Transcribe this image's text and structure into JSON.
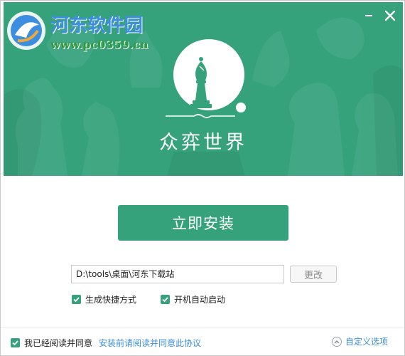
{
  "watermark": {
    "title": "河东软件园",
    "url": "www.pc0359.cn"
  },
  "header": {
    "brand": "众弈世界",
    "minimize_icon": "minimize-icon",
    "close_icon": "close-icon",
    "logo_icon": "chess-bishop-icon"
  },
  "install": {
    "button_label": "立即安装"
  },
  "path": {
    "value": "D:\\tools\\桌面\\河东下载站",
    "change_label": "更改"
  },
  "options": {
    "shortcut": {
      "label": "生成快捷方式",
      "checked": true
    },
    "autostart": {
      "label": "开机自动启动",
      "checked": true
    }
  },
  "footer": {
    "agree_label": "我已经阅读并同意",
    "agree_checked": true,
    "agreement_link": "安装前请阅读并同意此协议",
    "custom_label": "自定义选项",
    "custom_icon": "chevron-up-icon"
  },
  "colors": {
    "brand_green": "#36a27c",
    "link_blue": "#3b8fd8"
  }
}
